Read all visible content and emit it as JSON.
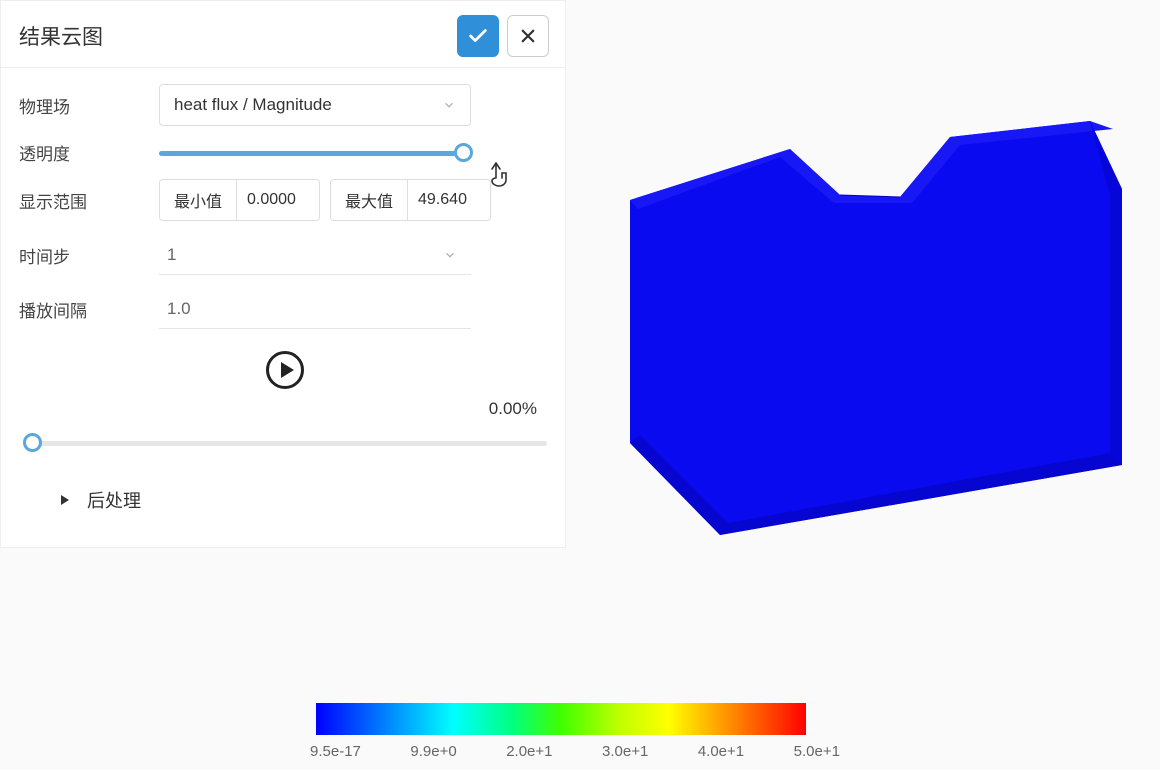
{
  "panel": {
    "title": "结果云图",
    "field_label": "物理场",
    "field_value": "heat flux / Magnitude",
    "opacity_label": "透明度",
    "range_label": "显示范围",
    "min_label": "最小值",
    "min_value": "0.0000",
    "max_label": "最大值",
    "max_value": "49.640",
    "timestep_label": "时间步",
    "timestep_value": "1",
    "interval_label": "播放间隔",
    "interval_value": "1.0",
    "percent": "0.00%",
    "postproc_label": "后处理"
  },
  "legend": {
    "ticks": [
      "9.5e-17",
      "9.9e+0",
      "2.0e+1",
      "3.0e+1",
      "4.0e+1",
      "5.0e+1"
    ]
  },
  "chart_data": {
    "type": "colormap-legend",
    "ticks": [
      9.5e-17,
      9.9,
      20,
      30,
      40,
      50
    ],
    "field": "heat flux / Magnitude",
    "colormap": "jet"
  }
}
